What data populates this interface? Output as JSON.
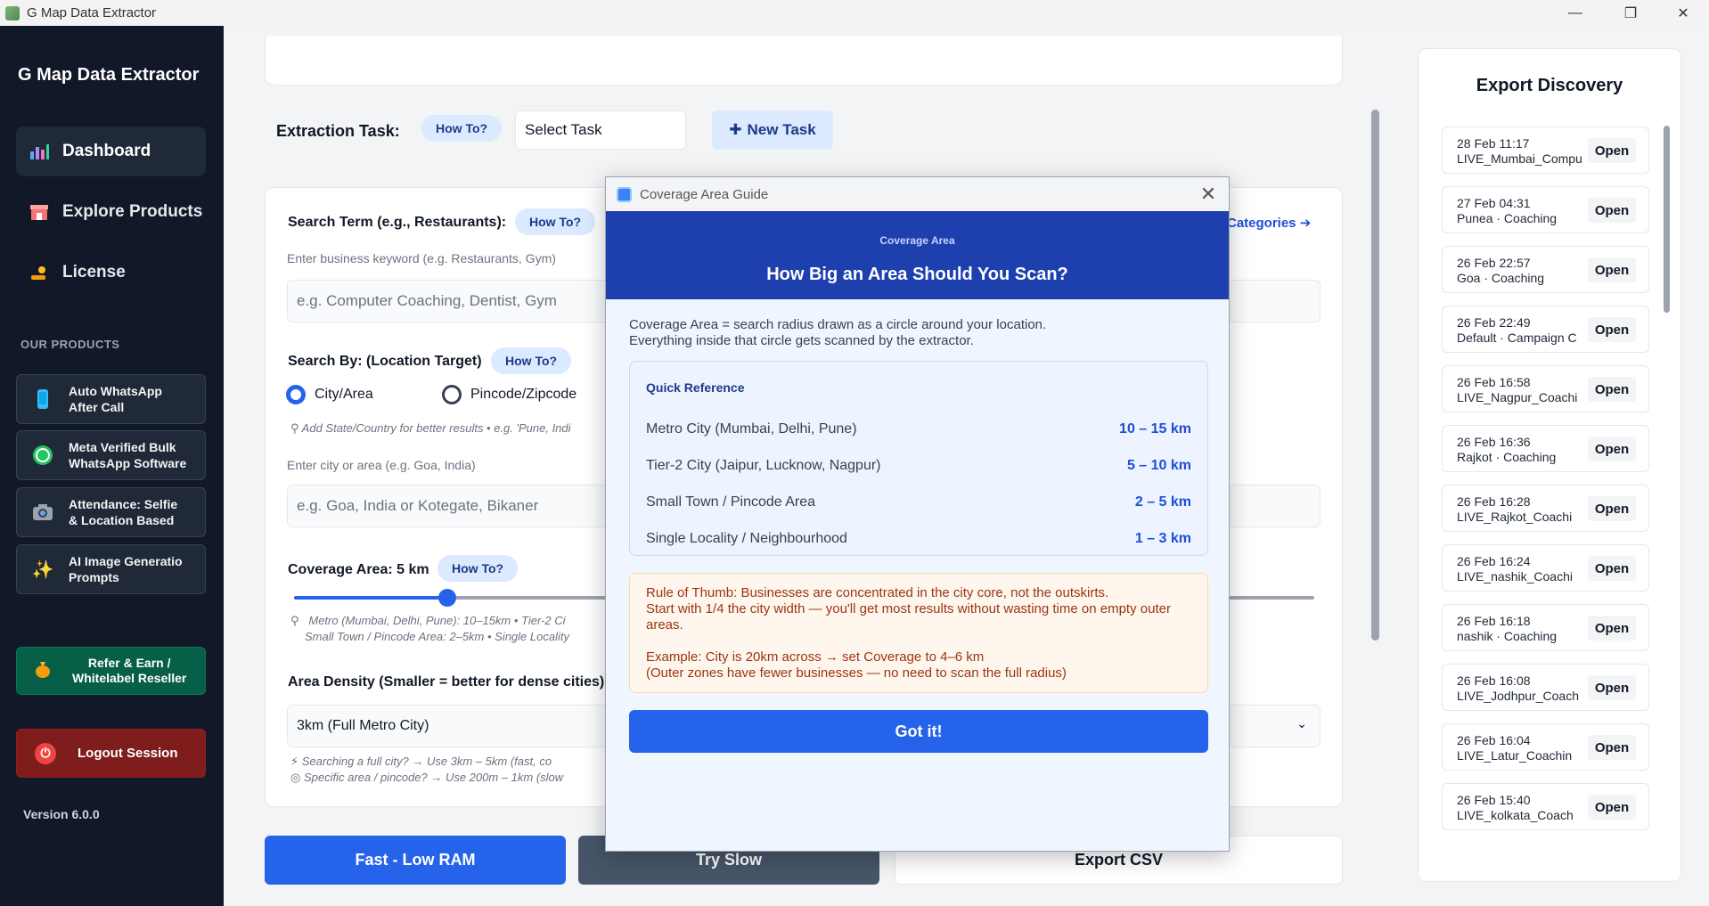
{
  "window": {
    "title": "G Map Data Extractor",
    "minimize": "—",
    "maximize": "❐",
    "close": "✕"
  },
  "sidebar": {
    "brand": "G Map Data Extractor",
    "nav": [
      {
        "label": "Dashboard",
        "icon": "chart-icon"
      },
      {
        "label": "Explore Products",
        "icon": "store-icon"
      },
      {
        "label": "License",
        "icon": "key-hand-icon"
      }
    ],
    "section_label": "OUR PRODUCTS",
    "products": [
      {
        "line1": "Auto WhatsApp",
        "line2": "After Call"
      },
      {
        "line1": "Meta Verified Bulk",
        "line2": "WhatsApp Software"
      },
      {
        "line1": "Attendance: Selfie",
        "line2": "& Location Based"
      },
      {
        "line1": "AI Image Generatio",
        "line2": "Prompts"
      }
    ],
    "refer": {
      "line1": "Refer & Earn /",
      "line2": "Whitelabel Reseller"
    },
    "logout": "Logout Session",
    "version": "Version 6.0.0"
  },
  "main": {
    "task_label": "Extraction Task:",
    "how_to": "How To?",
    "select_task": "Select Task",
    "new_task": "New Task",
    "search_term_label": "Search Term (e.g., Restaurants):",
    "categories_link": "Categories",
    "search_term_hint": "Enter business keyword (e.g. Restaurants, Gym)",
    "search_term_placeholder": "e.g. Computer Coaching, Dentist, Gym",
    "search_by_label": "Search By: (Location Target)",
    "radio_city": "City/Area",
    "radio_pincode": "Pincode/Zipcode",
    "state_hint": "Add State/Country for better results  •  e.g. 'Pune, Indi",
    "city_hint": "Enter city or area (e.g. Goa, India)",
    "city_placeholder": "e.g. Goa, India or Kotegate, Bikaner",
    "coverage_label": "Coverage Area: 5 km",
    "coverage_percent": 15,
    "coverage_hint1": "Metro (Mumbai, Delhi, Pune): 10–15km  •  Tier-2 Ci",
    "coverage_hint2": "Small Town / Pincode Area: 2–5km  •  Single Locality",
    "density_label": "Area Density (Smaller = better for dense cities):",
    "density_value": "3km (Full Metro City)",
    "density_hint1": "Searching a full city?  →  Use 3km – 5km   (fast, co",
    "density_hint2": "Specific area / pincode?  →  Use 200m – 1km   (slow",
    "btn_fast": "Fast - Low RAM",
    "btn_slow": "Try Slow",
    "btn_export": "Export CSV"
  },
  "export_panel": {
    "title": "Export Discovery",
    "open_label": "Open",
    "items": [
      {
        "date": "28 Feb 11:17",
        "name": "LIVE_Mumbai_Compu"
      },
      {
        "date": "27 Feb 04:31",
        "name": "Punea  ·  Coaching"
      },
      {
        "date": "26 Feb 22:57",
        "name": "Goa  ·  Coaching"
      },
      {
        "date": "26 Feb 22:49",
        "name": "Default  ·  Campaign C"
      },
      {
        "date": "26 Feb 16:58",
        "name": "LIVE_Nagpur_Coachi"
      },
      {
        "date": "26 Feb 16:36",
        "name": "Rajkot  ·  Coaching"
      },
      {
        "date": "26 Feb 16:28",
        "name": "LIVE_Rajkot_Coachi"
      },
      {
        "date": "26 Feb 16:24",
        "name": "LIVE_nashik_Coachi"
      },
      {
        "date": "26 Feb 16:18",
        "name": "nashik  ·  Coaching"
      },
      {
        "date": "26 Feb 16:08",
        "name": "LIVE_Jodhpur_Coach"
      },
      {
        "date": "26 Feb 16:04",
        "name": "LIVE_Latur_Coachin"
      },
      {
        "date": "26 Feb 15:40",
        "name": "LIVE_kolkata_Coach"
      }
    ]
  },
  "modal": {
    "window_title": "Coverage Area Guide",
    "kicker": "Coverage Area",
    "title": "How Big an Area Should You Scan?",
    "desc1": "Coverage Area = search radius drawn as a circle around your location.",
    "desc2": "Everything inside that circle gets scanned by the extractor.",
    "quick_ref_title": "Quick Reference",
    "rows": [
      {
        "k": "Metro City  (Mumbai, Delhi, Pune)",
        "v": "10 – 15 km"
      },
      {
        "k": "Tier-2 City  (Jaipur, Lucknow, Nagpur)",
        "v": "5 – 10 km"
      },
      {
        "k": "Small Town / Pincode Area",
        "v": "2 – 5 km"
      },
      {
        "k": "Single Locality / Neighbourhood",
        "v": "1 – 3 km"
      }
    ],
    "rule1": "Rule of Thumb: Businesses are concentrated in the city core, not the outskirts.",
    "rule2": "Start with 1/4 the city width — you'll get most results without wasting time on empty outer areas.",
    "rule3": "Example: City is 20km across  →  set Coverage to 4–6 km",
    "rule4": "(Outer zones have fewer businesses — no need to scan the full radius)",
    "got_it": "Got it!"
  }
}
